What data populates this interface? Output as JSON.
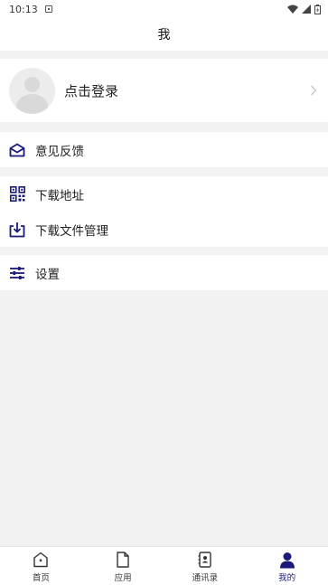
{
  "status_bar": {
    "time": "10:13"
  },
  "header": {
    "title": "我"
  },
  "login": {
    "label": "点击登录"
  },
  "menu": {
    "feedback": "意见反馈",
    "download_address": "下载地址",
    "download_manager": "下载文件管理",
    "settings": "设置"
  },
  "tabs": [
    {
      "label": "首页",
      "icon": "home-icon"
    },
    {
      "label": "应用",
      "icon": "document-icon"
    },
    {
      "label": "通讯录",
      "icon": "contacts-icon"
    },
    {
      "label": "我的",
      "icon": "person-icon"
    }
  ],
  "colors": {
    "accent": "#1a1a7a",
    "background": "#f2f2f2"
  }
}
